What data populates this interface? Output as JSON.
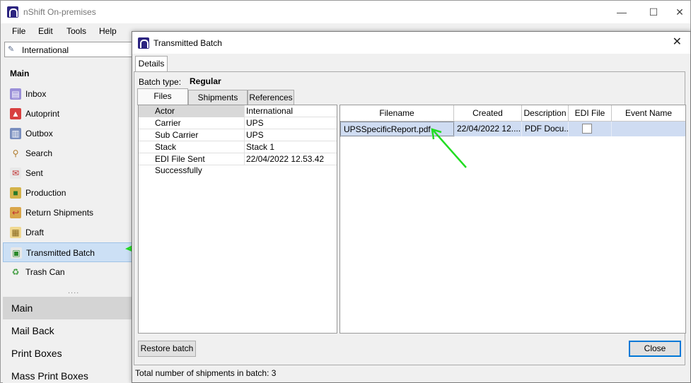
{
  "app": {
    "title": "nShift On-premises",
    "controls": {
      "minimize": "—",
      "maximize": "☐",
      "close": "✕"
    }
  },
  "menu": [
    "File",
    "Edit",
    "Tools",
    "Help"
  ],
  "sidebar": {
    "combo_value": "International",
    "header": "Main",
    "items": [
      {
        "label": "Inbox",
        "icon": "inbox-icon"
      },
      {
        "label": "Autoprint",
        "icon": "autoprint-icon"
      },
      {
        "label": "Outbox",
        "icon": "outbox-icon"
      },
      {
        "label": "Search",
        "icon": "search-icon"
      },
      {
        "label": "Sent",
        "icon": "sent-icon"
      },
      {
        "label": "Production",
        "icon": "production-icon"
      },
      {
        "label": "Return Shipments",
        "icon": "return-icon"
      },
      {
        "label": "Draft",
        "icon": "draft-icon"
      },
      {
        "label": "Transmitted Batch",
        "icon": "transmitted-batch-icon",
        "active": true
      },
      {
        "label": "Trash Can",
        "icon": "trash-icon"
      }
    ],
    "dots": "....",
    "sections": [
      "Main",
      "Mail Back",
      "Print Boxes",
      "Mass Print Boxes"
    ]
  },
  "dialog": {
    "title": "Transmitted Batch",
    "close": "✕",
    "tab": "Details",
    "batch_type_label": "Batch type:",
    "batch_type_value": "Regular",
    "subtabs": [
      "Files",
      "Shipments",
      "References"
    ],
    "details": [
      {
        "key": "Actor",
        "value": "International"
      },
      {
        "key": "Carrier",
        "value": "UPS"
      },
      {
        "key": "Sub Carrier",
        "value": "UPS"
      },
      {
        "key": "Stack",
        "value": "Stack 1"
      },
      {
        "key": "EDI File Sent Successfully",
        "value": "22/04/2022 12.53.42"
      }
    ],
    "files_columns": [
      "Filename",
      "Created",
      "Description",
      "EDI File",
      "Event Name"
    ],
    "files_rows": [
      {
        "filename": "UPSSpecificReport.pdf",
        "created": "22/04/2022 12....",
        "description": "PDF Docu...",
        "edi_file": false,
        "event_name": ""
      }
    ],
    "restore_button": "Restore batch",
    "close_button": "Close",
    "status": "Total number of shipments in batch: 3"
  },
  "colors": {
    "arrow": "#22dd22",
    "selection": "#cfdcf2",
    "brand": "#2c2480"
  }
}
